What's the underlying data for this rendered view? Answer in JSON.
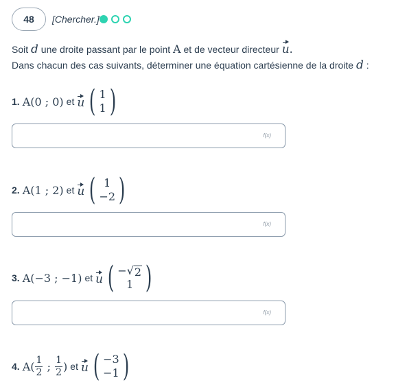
{
  "header": {
    "exercise_number": "48",
    "tag": "[Chercher.]",
    "progress_dots": [
      "filled",
      "empty",
      "empty"
    ],
    "accent_color": "#2ed3b1"
  },
  "intro": {
    "line1_prefix": "Soit ",
    "line1_var_d": "d",
    "line1_mid": " une droite passant par le point ",
    "line1_point": "A",
    "line1_mid2": " et de vecteur directeur ",
    "line1_vec": "u",
    "line1_end": ".",
    "line2_text": "Dans chacun des cas suivants, déterminer une équation cartésienne de la droite ",
    "line2_var": "d",
    "line2_end": " :"
  },
  "questions": [
    {
      "number": "1.",
      "point_label": "A(0 ; 0)",
      "et": "et",
      "vec": "u",
      "comp_top": "1",
      "comp_bottom": "1"
    },
    {
      "number": "2.",
      "point_label": "A(1 ; 2)",
      "et": "et",
      "vec": "u",
      "comp_top": "1",
      "comp_bottom": "−2"
    },
    {
      "number": "3.",
      "point_label": "A(−3 ; −1)",
      "et": "et",
      "vec": "u",
      "comp_top_sign": "−",
      "comp_top_radicand": "2",
      "comp_bottom": "1"
    },
    {
      "number": "4.",
      "point_prefix": "A(",
      "frac1_num": "1",
      "frac1_den": "2",
      "sep": " ; ",
      "frac2_num": "1",
      "frac2_den": "2",
      "point_suffix": ")",
      "et": "et",
      "vec": "u",
      "comp_top": "−3",
      "comp_bottom": "−1"
    }
  ],
  "answer_field": {
    "fx_label": "f(x)"
  }
}
